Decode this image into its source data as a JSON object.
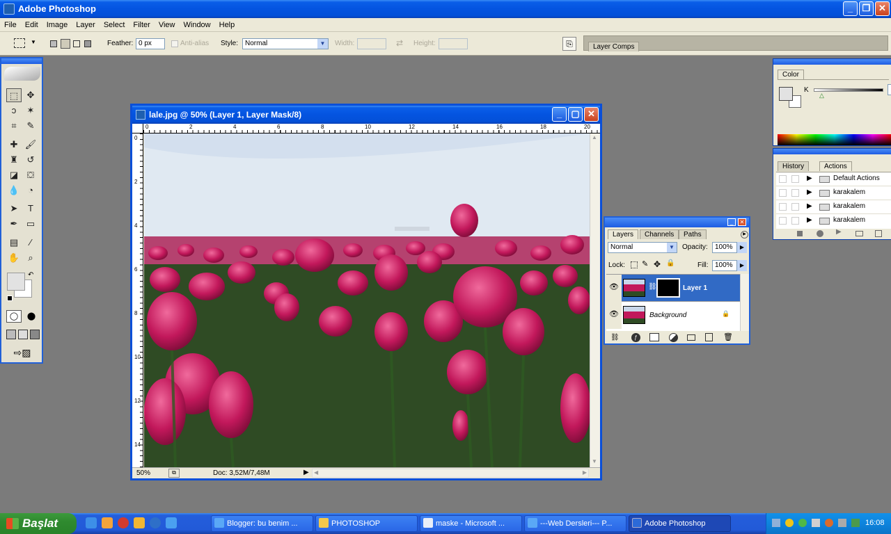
{
  "window": {
    "title": "Adobe Photoshop"
  },
  "menu": [
    "File",
    "Edit",
    "Image",
    "Layer",
    "Select",
    "Filter",
    "View",
    "Window",
    "Help"
  ],
  "options": {
    "feather_label": "Feather:",
    "feather_value": "0 px",
    "antialias_label": "Anti-alias",
    "style_label": "Style:",
    "style_value": "Normal",
    "width_label": "Width:",
    "height_label": "Height:",
    "layer_comps_tab": "Layer Comps"
  },
  "document": {
    "title": "lale.jpg @ 50% (Layer 1, Layer Mask/8)",
    "zoom": "50%",
    "doc_info": "Doc: 3,52M/7,48M",
    "ruler_top": [
      "0",
      "2",
      "4",
      "6",
      "8",
      "10",
      "12",
      "14",
      "16",
      "18",
      "20"
    ],
    "ruler_left": [
      "0",
      "2",
      "4",
      "6",
      "8",
      "10",
      "12",
      "14"
    ]
  },
  "color_panel": {
    "tab": "Color",
    "channel": "K"
  },
  "history_panel": {
    "tabs": [
      "History",
      "Actions"
    ],
    "actions": [
      "Default Actions",
      "karakalem",
      "karakalem",
      "karakalem"
    ]
  },
  "layers_panel": {
    "tabs": [
      "Layers",
      "Channels",
      "Paths"
    ],
    "blend_mode": "Normal",
    "opacity_label": "Opacity:",
    "opacity": "100%",
    "lock_label": "Lock:",
    "fill_label": "Fill:",
    "fill": "100%",
    "layers": [
      "Layer 1",
      "Background"
    ]
  },
  "taskbar": {
    "start": "Başlat",
    "buttons": [
      "Blogger: bu benim ...",
      "PHOTOSHOP",
      "maske - Microsoft ...",
      "---Web Dersleri--- P...",
      "Adobe Photoshop"
    ],
    "clock": "16:08"
  },
  "colors": {
    "xp_blue": "#0454e0",
    "panel_bg": "#ece9d8",
    "workspace": "#7b7b7b",
    "tulip": "#c2185b"
  }
}
